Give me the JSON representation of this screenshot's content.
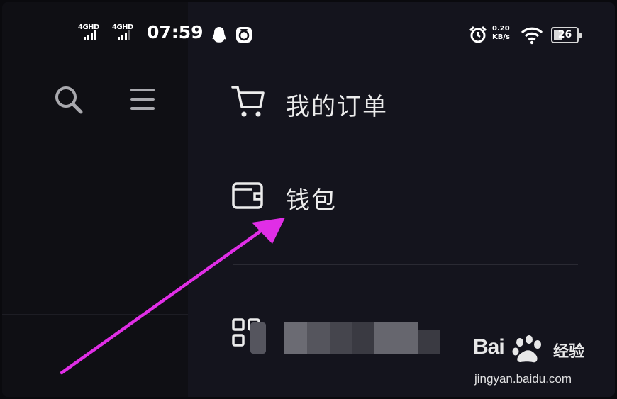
{
  "status_bar": {
    "signal_1": "4GHD",
    "signal_2": "4GHD",
    "time": "07:59",
    "icons": [
      "qq-penguin-icon",
      "alarm-app-icon",
      "alarm-clock-icon",
      "wifi-icon"
    ],
    "net_speed_value": "0.20",
    "net_speed_unit": "KB/s",
    "battery": "26"
  },
  "sidebar": {
    "icons": [
      "search-icon",
      "hamburger-menu-icon"
    ]
  },
  "menu": {
    "items": [
      {
        "label": "我的订单",
        "icon": "shopping-cart-icon"
      },
      {
        "label": "钱包",
        "icon": "wallet-icon"
      },
      {
        "label": "",
        "icon": "grid-apps-icon"
      }
    ]
  },
  "annotation": {
    "arrow_color": "#e02ee6",
    "arrow_target": "钱包"
  },
  "watermark": {
    "brand_latin": "Bai",
    "brand_cn": "经验",
    "url": "jingyan.baidu.com"
  },
  "colors": {
    "background": "#14141d",
    "left_pane": "#0f0f14",
    "text": "#ececec",
    "arrow": "#e02ee6"
  }
}
